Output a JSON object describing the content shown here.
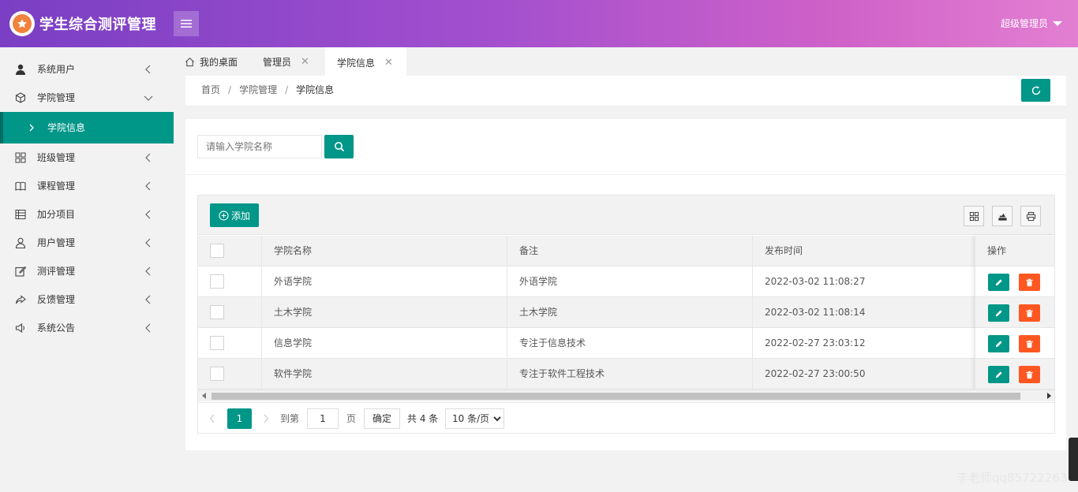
{
  "header": {
    "app_title": "学生综合测评管理",
    "user_name": "超级管理员"
  },
  "sidebar": {
    "items": [
      {
        "label": "系统用户",
        "icon": "user-solid-icon"
      },
      {
        "label": "学院管理",
        "icon": "cube-icon",
        "expanded": true
      },
      {
        "label": "班级管理",
        "icon": "grid-icon"
      },
      {
        "label": "课程管理",
        "icon": "book-icon"
      },
      {
        "label": "加分项目",
        "icon": "list-table-icon"
      },
      {
        "label": "用户管理",
        "icon": "user-outline-icon"
      },
      {
        "label": "测评管理",
        "icon": "edit-icon"
      },
      {
        "label": "反馈管理",
        "icon": "share-icon"
      },
      {
        "label": "系统公告",
        "icon": "speaker-icon"
      }
    ],
    "active_subitem": "学院信息"
  },
  "tabs": [
    {
      "label": "我的桌面",
      "icon": "home-icon",
      "closable": false
    },
    {
      "label": "管理员",
      "closable": true
    },
    {
      "label": "学院信息",
      "closable": true,
      "active": true
    }
  ],
  "breadcrumb": {
    "home": "首页",
    "parent": "学院管理",
    "current": "学院信息",
    "separator": "/"
  },
  "search": {
    "placeholder": "请输入学院名称",
    "value": ""
  },
  "toolbar": {
    "add_label": "添加"
  },
  "table": {
    "headers": {
      "name": "学院名称",
      "note": "备注",
      "time": "发布时间",
      "ops": "操作"
    },
    "rows": [
      {
        "name": "外语学院",
        "note": "外语学院",
        "time": "2022-03-02 11:08:27"
      },
      {
        "name": "土木学院",
        "note": "土木学院",
        "time": "2022-03-02 11:08:14"
      },
      {
        "name": "信息学院",
        "note": "专注于信息技术",
        "time": "2022-02-27 23:03:12"
      },
      {
        "name": "软件学院",
        "note": "专注于软件工程技术",
        "time": "2022-02-27 23:00:50"
      }
    ]
  },
  "pager": {
    "current_page": "1",
    "goto_label": "到第",
    "goto_value": "1",
    "page_unit": "页",
    "confirm_label": "确定",
    "total_label": "共 4 条",
    "page_size": "10 条/页"
  },
  "colors": {
    "primary": "#009688",
    "danger": "#ff5722",
    "header_start": "#7a3fc4",
    "header_end": "#e27fd2"
  },
  "watermark": "李老师qq85722263"
}
